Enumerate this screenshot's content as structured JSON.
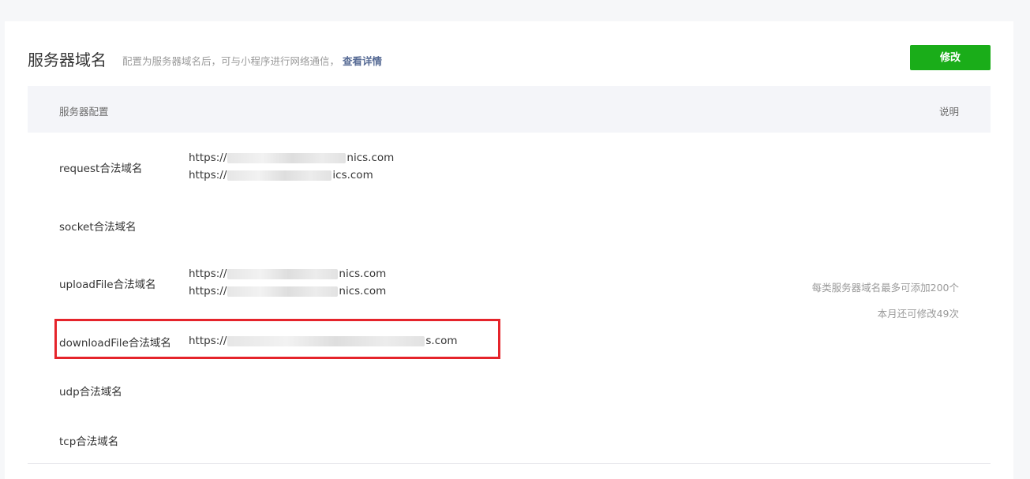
{
  "section": {
    "title": "服务器域名",
    "subtitle": "配置为服务器域名后，可与小程序进行网络通信，",
    "detail_link": "查看详情",
    "modify_button": "修改"
  },
  "table": {
    "header_left": "服务器配置",
    "header_right": "说明"
  },
  "rows": [
    {
      "label": "request合法域名",
      "values": [
        "https://",
        "https://"
      ],
      "suffixes": [
        "nics.com",
        "ics.com"
      ]
    },
    {
      "label": "socket合法域名",
      "values": []
    },
    {
      "label": "uploadFile合法域名",
      "values": [
        "https://",
        "https://"
      ],
      "suffixes": [
        "nics.com",
        "nics.com"
      ]
    },
    {
      "label": "downloadFile合法域名",
      "values": [
        "https://"
      ],
      "suffixes": [
        "s.com"
      ]
    },
    {
      "label": "udp合法域名",
      "values": []
    },
    {
      "label": "tcp合法域名",
      "values": []
    }
  ],
  "notes": {
    "limit": "每类服务器域名最多可添加200个",
    "remaining": "本月还可修改49次"
  },
  "colors": {
    "primary_button": "#1aad19",
    "link": "#576b95",
    "highlight_box": "#e5242b"
  }
}
